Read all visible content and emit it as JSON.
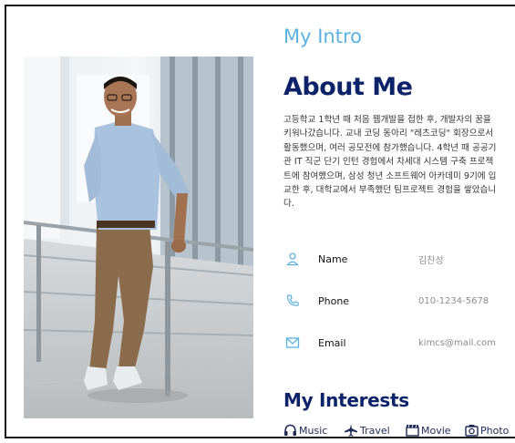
{
  "intro": {
    "kicker": "My Intro",
    "heading": "About Me",
    "bio_lines": [
      "고등학교 1학년 때 처음 웹개발을 접한 후, 개발자의 꿈을",
      "키워나갔습니다. 교내 코딩 동아리 \"레츠코딩\" 회장으로서",
      "활동했으며, 여러 공모전에 참가했습니다. 4학년 때 공공기",
      "관 IT 직군 단기 인턴 경험에서 차세대 시스템 구축 프로젝",
      "트에 참여했으며, 삼성 청년 소프트웨어 아카데미 9기에 입",
      "교한 후, 대학교에서 부족했던 팀프로젝트 경험을 쌓았습니",
      "다."
    ]
  },
  "contact": [
    {
      "icon": "person-icon",
      "label": "Name",
      "value": "김찬성"
    },
    {
      "icon": "phone-icon",
      "label": "Phone",
      "value": "010-1234-5678"
    },
    {
      "icon": "envelope-icon",
      "label": "Email",
      "value": "kimcs@mail.com"
    }
  ],
  "interests": {
    "title": "My Interests",
    "items": [
      {
        "icon": "headphones-icon",
        "label": "Music"
      },
      {
        "icon": "airplane-icon",
        "label": "Travel"
      },
      {
        "icon": "clapperboard-icon",
        "label": "Movie"
      },
      {
        "icon": "camera-icon",
        "label": "Photo"
      }
    ]
  },
  "colors": {
    "accent_light": "#5bb1e0",
    "accent_dark": "#0d2369"
  }
}
